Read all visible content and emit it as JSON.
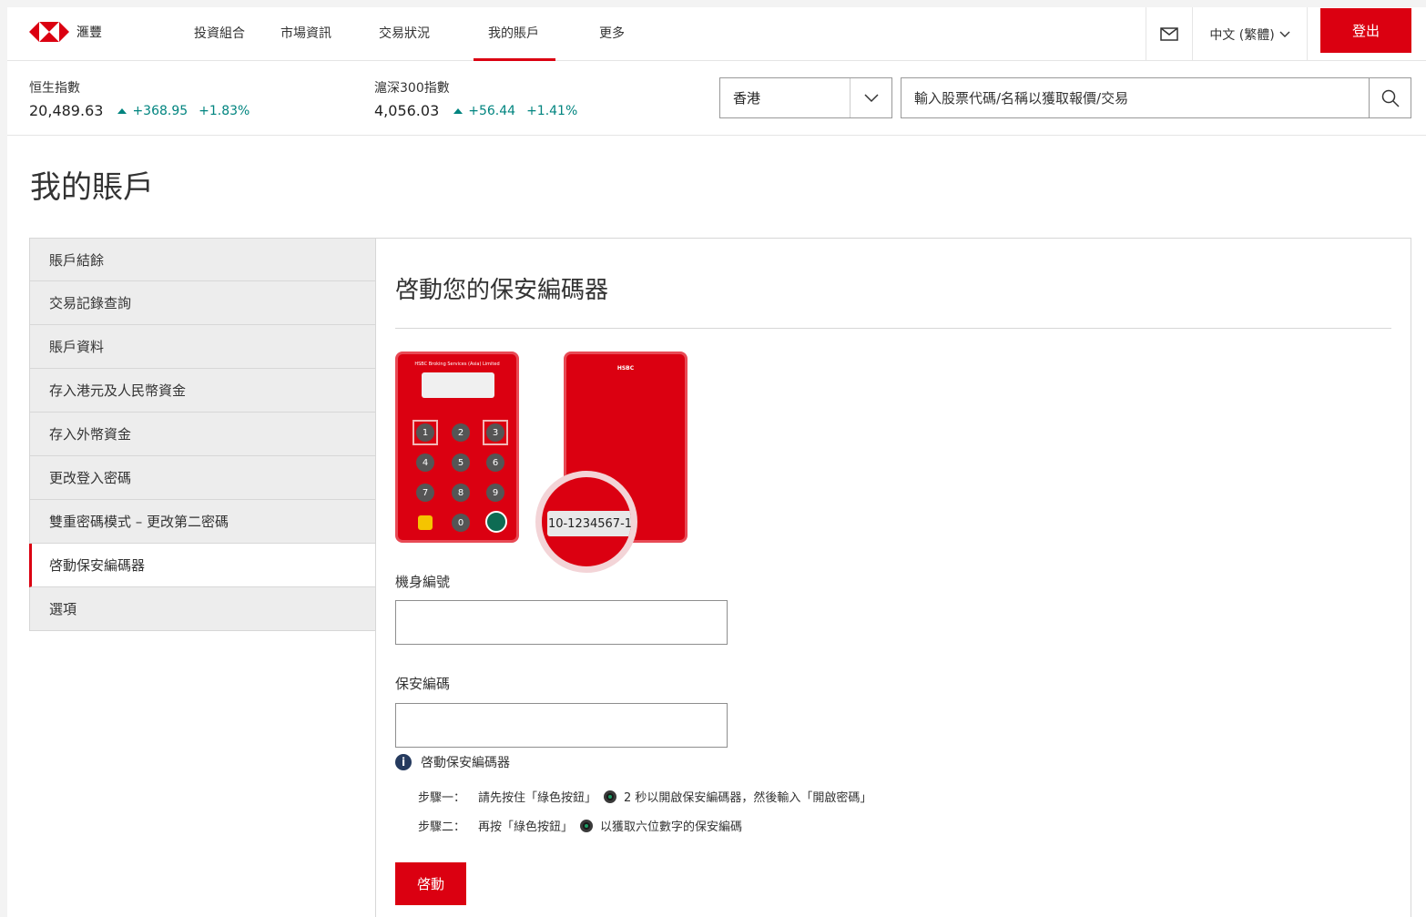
{
  "brand": {
    "name": "滙豐",
    "accent": "#db0011"
  },
  "nav": {
    "items": [
      "投資組合",
      "市場資訊",
      "交易狀況",
      "我的賬戶",
      "更多"
    ],
    "active": "我的賬戶",
    "language": "中文 (繁體)",
    "logout": "登出"
  },
  "indices": [
    {
      "name": "恒生指數",
      "value": "20,489.63",
      "change": "+368.95",
      "pct": "+1.83%"
    },
    {
      "name": "滬深300指數",
      "value": "4,056.03",
      "change": "+56.44",
      "pct": "+1.41%"
    }
  ],
  "market": {
    "selected": "香港"
  },
  "search": {
    "placeholder": "輸入股票代碼/名稱以獲取報價/交易"
  },
  "page_title": "我的賬戶",
  "sidebar": {
    "items": [
      "賬戶結餘",
      "交易記錄查詢",
      "賬戶資料",
      "存入港元及人民幣資金",
      "存入外幣資金",
      "更改登入密碼",
      "雙重密碼模式 – 更改第二密碼",
      "啓動保安編碼器",
      "選項"
    ],
    "active_index": 7
  },
  "content": {
    "title": "啓動您的保安編碼器",
    "device": {
      "header": "HSBC Broking Services (Asia) Limited",
      "keys": [
        "1",
        "2",
        "3",
        "4",
        "5",
        "6",
        "7",
        "8",
        "9",
        "",
        "0",
        ""
      ],
      "back_logo": "HSBC",
      "serial_sample": "10-1234567-1"
    },
    "serial_label": "機身編號",
    "code_label": "保安編碼",
    "info_title": "啓動保安編碼器",
    "step1_label": "步驟一：",
    "step1_a": "請先按住「綠色按鈕」",
    "step1_b": "2 秒以開啟保安編碼器，然後輸入「開啟密碼」",
    "step2_label": "步驟二：",
    "step2_a": "再按「綠色按鈕」",
    "step2_b": "以獲取六位數字的保安編碼",
    "submit": "啓動"
  }
}
